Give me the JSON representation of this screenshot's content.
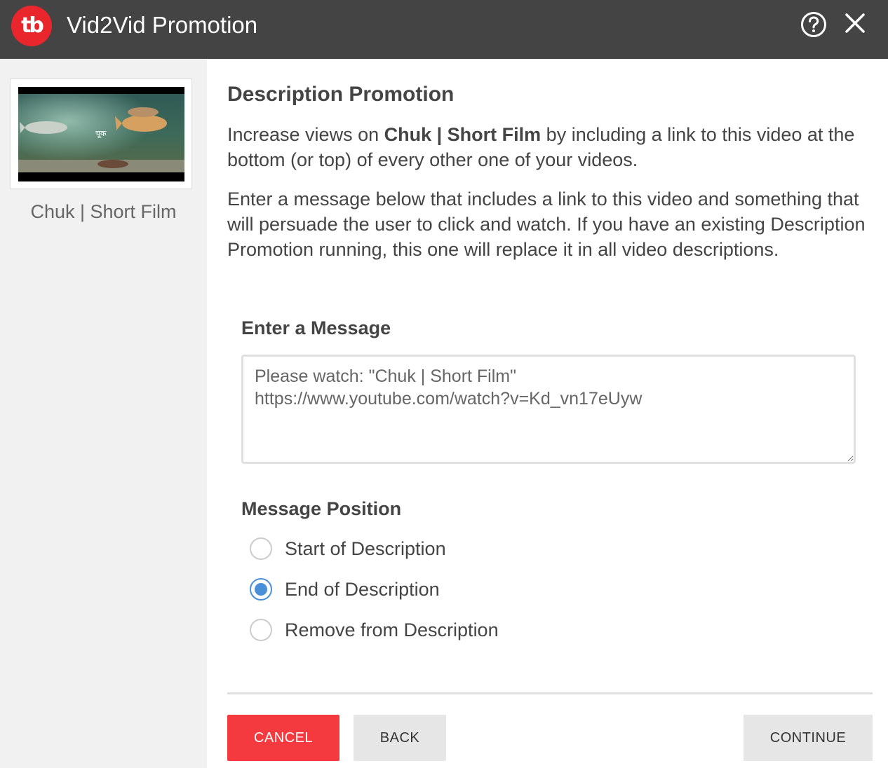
{
  "header": {
    "logo_text": "tb",
    "title": "Vid2Vid Promotion",
    "help_icon": "help-circle-icon",
    "close_icon": "close-icon",
    "background": "#444444",
    "brand_color": "#e8262c"
  },
  "sidebar": {
    "thumbnail_icon": "video-thumbnail",
    "video_title": "Chuk | Short Film"
  },
  "main": {
    "section_title": "Description Promotion",
    "intro_before": "Increase views on ",
    "intro_video": "Chuk | Short Film",
    "intro_after": " by including a link to this video at the bottom (or top) of every other one of your videos.",
    "description": "Enter a message below that includes a link to this video and something that will persuade the user to click and watch. If you have an existing Description Promotion running, this one will replace it in all video descriptions.",
    "message_label": "Enter a Message",
    "message_value": "Please watch: \"Chuk | Short Film\"\nhttps://www.youtube.com/watch?v=Kd_vn17eUyw",
    "position_label": "Message Position",
    "positions": [
      {
        "label": "Start of Description",
        "checked": false
      },
      {
        "label": "End of Description",
        "checked": true
      },
      {
        "label": "Remove from Description",
        "checked": false
      }
    ],
    "radio_color": "#4a90d9"
  },
  "footer": {
    "cancel_label": "CANCEL",
    "back_label": "BACK",
    "continue_label": "CONTINUE",
    "cancel_color": "#f43a3f"
  }
}
